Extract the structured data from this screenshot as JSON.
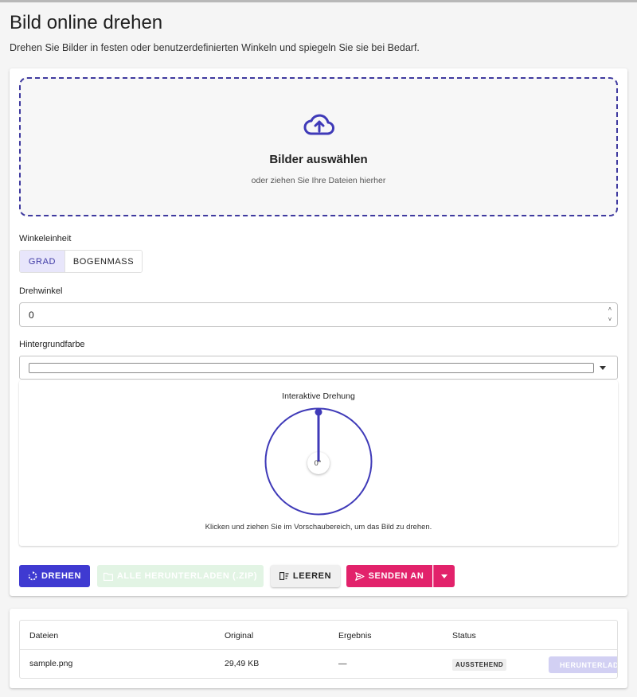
{
  "page": {
    "title": "Bild online drehen",
    "subtitle": "Drehen Sie Bilder in festen oder benutzerdefinierten Winkeln und spiegeln Sie sie bei Bedarf."
  },
  "dropzone": {
    "icon": "cloud-upload-icon",
    "title": "Bilder auswählen",
    "hint": "oder ziehen Sie Ihre Dateien hierher"
  },
  "angle_unit": {
    "label": "Winkeleinheit",
    "options": [
      "GRAD",
      "BOGENMASS"
    ],
    "selected": "GRAD"
  },
  "rotation_angle": {
    "label": "Drehwinkel",
    "value": "0",
    "spin_up": "˄",
    "spin_down": "˅"
  },
  "background_color": {
    "label": "Hintergrundfarbe",
    "value": "#ffffff"
  },
  "preview": {
    "title": "Interaktive Drehung",
    "angle_label": "0°",
    "hint": "Klicken und ziehen Sie im Vorschaubereich, um das Bild zu drehen.",
    "accent": "#3f3ab8"
  },
  "actions": {
    "rotate": "DREHEN",
    "download_all": "ALLE HERUNTERLADEN (.ZIP)",
    "clear": "LEEREN",
    "send_to": "SENDEN AN"
  },
  "files_table": {
    "headers": [
      "Dateien",
      "Original",
      "Ergebnis",
      "Status"
    ],
    "rows": [
      {
        "file": "sample.png",
        "original": "29,49 KB",
        "result": "—",
        "status": "AUSSTEHEND",
        "download": "HERUNTERLADEN"
      }
    ]
  },
  "colors": {
    "primary": "#3f3ad1",
    "pink": "#e2226b",
    "success_disabled": "#e2f4e4"
  }
}
